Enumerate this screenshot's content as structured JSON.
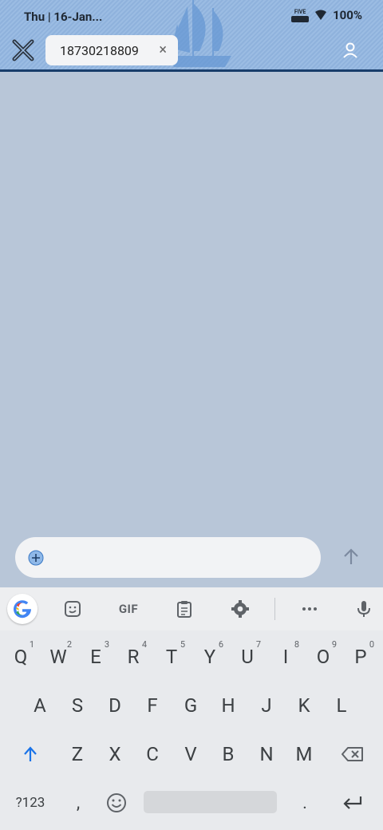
{
  "status_bar": {
    "time": "Thu | 16-Jan...",
    "carrier": "FIVE",
    "battery": "100%"
  },
  "header": {
    "contact_chip": "18730218809",
    "chip_close": "×"
  },
  "compose": {
    "placeholder": ""
  },
  "keyboard": {
    "toolbar": {
      "gif_label": "GIF"
    },
    "row1": [
      {
        "label": "Q",
        "hint": "1"
      },
      {
        "label": "W",
        "hint": "2"
      },
      {
        "label": "E",
        "hint": "3"
      },
      {
        "label": "R",
        "hint": "4"
      },
      {
        "label": "T",
        "hint": "5"
      },
      {
        "label": "Y",
        "hint": "6"
      },
      {
        "label": "U",
        "hint": "7"
      },
      {
        "label": "I",
        "hint": "8"
      },
      {
        "label": "O",
        "hint": "9"
      },
      {
        "label": "P",
        "hint": "0"
      }
    ],
    "row2": [
      "A",
      "S",
      "D",
      "F",
      "G",
      "H",
      "J",
      "K",
      "L"
    ],
    "row3": [
      "Z",
      "X",
      "C",
      "V",
      "B",
      "N",
      "M"
    ],
    "symbols_key": "?123",
    "comma_key": ",",
    "period_key": "."
  },
  "colors": {
    "header_bg": "#9bbce3",
    "header_border": "#183d6b",
    "chat_bg": "#b8c6d8",
    "accent_blue": "#1a73e8"
  }
}
